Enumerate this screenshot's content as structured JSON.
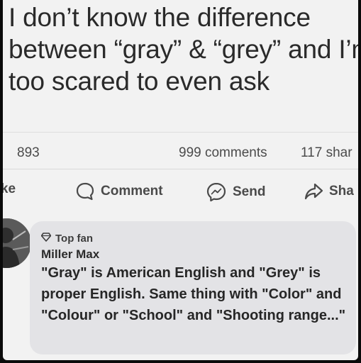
{
  "post": {
    "text": "I don’t know the difference between “gray” & “grey” and I’m too scared to even ask"
  },
  "stats": {
    "reactions": "893",
    "comments": "999 comments",
    "shares": "117 shar"
  },
  "actions": {
    "like_label": "Like",
    "comment_label": "Comment",
    "send_label": "Send",
    "share_label": "Sha"
  },
  "comment": {
    "badge": "Top fan",
    "author": "Miller Max",
    "text": "\"Gray\" is American English and \"Grey\" is proper English. Same thing with \"Color\" and \"Colour\" or \"School\" and \"Shooting range...\""
  },
  "icons": {
    "comment": "speech-bubble-icon",
    "send": "messenger-icon",
    "share": "share-arrow-icon",
    "badge": "diamond-icon"
  }
}
